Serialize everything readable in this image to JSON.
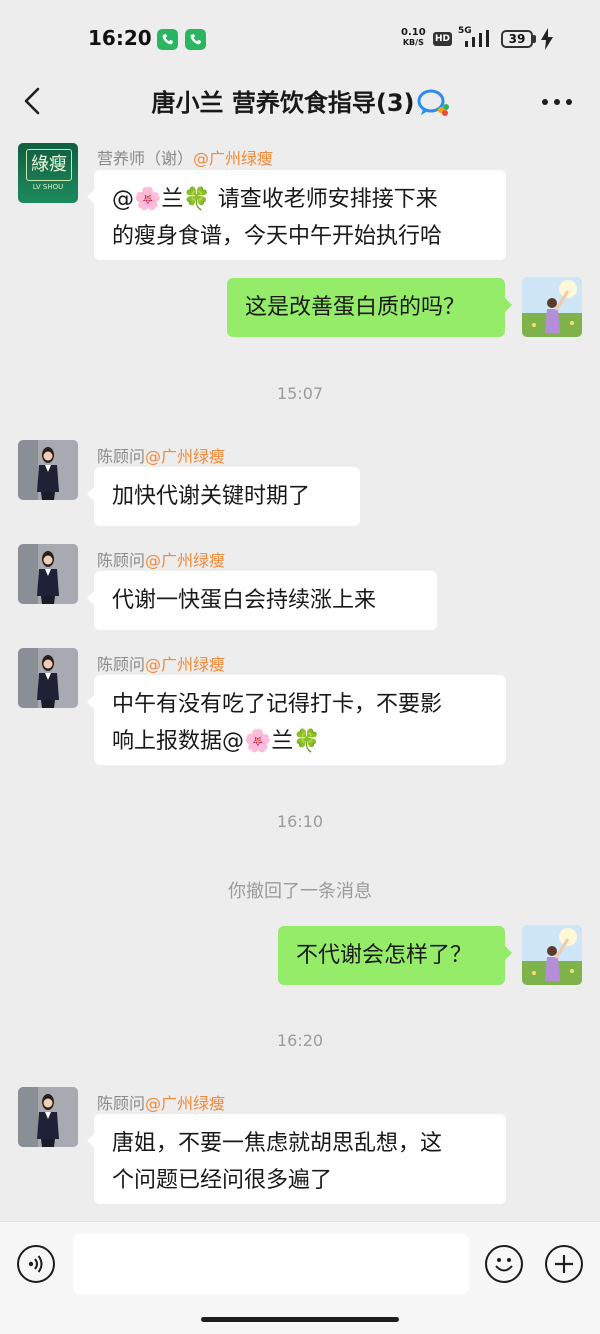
{
  "status_bar": {
    "time": "16:20",
    "net_speed_value": "0.10",
    "net_speed_unit": "KB/S",
    "hd": "HD",
    "network": "5G",
    "battery": "39"
  },
  "header": {
    "title": "唐小兰 营养饮食指导(3)"
  },
  "colors": {
    "background": "#ededed",
    "my_bubble": "#95ec69",
    "other_bubble": "#ffffff",
    "group_tag": "#f08a3c",
    "wechat_green": "#2ab661"
  },
  "messages": [
    {
      "sender": "营养师（谢）",
      "sender_tag": "@广州绿瘦",
      "avatar_text": "綠瘦",
      "avatar_sub": "LV SHOU",
      "lines": [
        "@🌸兰🍀 请查收老师安排接下来",
        "的瘦身食谱，今天中午开始执行哈"
      ]
    },
    {
      "text": "这是改善蛋白质的吗？"
    },
    {
      "timestamp": "15:07"
    },
    {
      "sender": "陈顾问",
      "sender_tag": "@广州绿瘦",
      "text": "加快代谢关键时期了"
    },
    {
      "sender": "陈顾问",
      "sender_tag": "@广州绿瘦",
      "text": "代谢一快蛋白会持续涨上来"
    },
    {
      "sender": "陈顾问",
      "sender_tag": "@广州绿瘦",
      "lines": [
        "中午有没有吃了记得打卡，不要影",
        "响上报数据@🌸兰🍀"
      ]
    },
    {
      "timestamp": "16:10"
    },
    {
      "system": "你撤回了一条消息"
    },
    {
      "text": "不代谢会怎样了？"
    },
    {
      "timestamp": "16:20"
    },
    {
      "sender": "陈顾问",
      "sender_tag": "@广州绿瘦",
      "lines": [
        "唐姐，不要一焦虑就胡思乱想，这",
        "个问题已经问很多遍了"
      ]
    }
  ],
  "input_bar": {
    "voice_icon": "voice-icon",
    "emoji_icon": "emoji-icon",
    "plus_icon": "plus-icon",
    "message_value": ""
  }
}
